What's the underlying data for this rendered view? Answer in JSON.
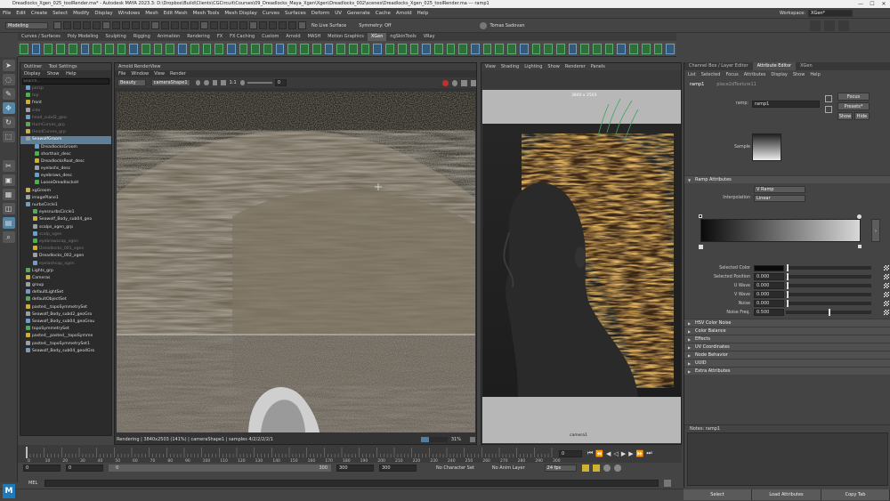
{
  "window": {
    "title": "Dreadlocks_Xgen_025_toolRender.ma* - Autodesk MAYA 2023.3: D:\\Dropbox\\Build\\Clients\\CGCircuit\\Courses\\09_Dreadlocks_Maya_Xgen\\Xgen\\Dreadlocks_002\\scenes\\Dreadlocks_Xgen_025_toolRender.ma --- ramp1",
    "controls": [
      "—",
      "☐",
      "✕"
    ]
  },
  "menu": [
    "File",
    "Edit",
    "Create",
    "Select",
    "Modify",
    "Display",
    "Windows",
    "Mesh",
    "Edit Mesh",
    "Mesh Tools",
    "Mesh Display",
    "Curves",
    "Surfaces",
    "Deform",
    "UV",
    "Generate",
    "Cache",
    "Arnold",
    "Help"
  ],
  "workspace": {
    "label": "Workspace:",
    "value": "XGen*"
  },
  "status": {
    "mode": "Modeling",
    "live_surface": "No Live Surface",
    "symmetry": "Symmetry: Off",
    "user": "Tomas Sadovan"
  },
  "shelf_tabs": [
    "Curves / Surfaces",
    "Poly Modeling",
    "Sculpting",
    "Rigging",
    "Animation",
    "Rendering",
    "FX",
    "FX Caching",
    "Custom",
    "Arnold",
    "MASH",
    "Motion Graphics",
    "XGen",
    "ngSkinTools",
    "VRay"
  ],
  "shelf_active": "XGen",
  "outliner": {
    "tabs": [
      "Outliner",
      "Tool Settings"
    ],
    "menu": [
      "Display",
      "Show",
      "Help"
    ],
    "search_placeholder": "Search...",
    "items": [
      {
        "label": "persp",
        "dim": true
      },
      {
        "label": "top",
        "dim": true
      },
      {
        "label": "front",
        "dim": false
      },
      {
        "label": "side",
        "dim": true
      },
      {
        "label": "head_subd2_geo",
        "dim": true
      },
      {
        "label": "HumCurves_grp",
        "dim": true
      },
      {
        "label": "HeadCurves_grp",
        "dim": true
      },
      {
        "label": "SeawolfGroom",
        "dim": false
      },
      {
        "label": "DreadlocksGroom",
        "dim": false
      },
      {
        "label": "shorthair_desc",
        "dim": false
      },
      {
        "label": "DreadlocksRoot_desc",
        "dim": false
      },
      {
        "label": "eyelashs_desc",
        "dim": false
      },
      {
        "label": "eyebrows_desc",
        "dim": false
      },
      {
        "label": "LooseDreadlocksH",
        "dim": false
      },
      {
        "label": "xgGroom",
        "dim": false
      },
      {
        "label": "imagePlane1",
        "dim": false
      },
      {
        "label": "nurbsCircle1",
        "dim": false
      },
      {
        "label": "eyesnurbsCircle1",
        "dim": false
      },
      {
        "label": "Seawolf_Body_sub04_geo",
        "dim": false
      },
      {
        "label": "scalps_xgen_grp",
        "dim": false
      },
      {
        "label": "scalp_xgen",
        "dim": true
      },
      {
        "label": "eyebrowscap_xgen",
        "dim": true
      },
      {
        "label": "Dreadlocks_001_xgen",
        "dim": true
      },
      {
        "label": "Dreadlocks_002_xgen",
        "dim": false
      },
      {
        "label": "eyelashcap_xgen",
        "dim": true
      },
      {
        "label": "Lights_grp",
        "dim": false
      },
      {
        "label": "Cameras",
        "dim": false
      },
      {
        "label": "group",
        "dim": false
      },
      {
        "label": "defaultLightSet",
        "dim": false
      },
      {
        "label": "defaultObjectSet",
        "dim": false
      },
      {
        "label": "pasted__topoSymmetrySet",
        "dim": false
      },
      {
        "label": "Seawolf_Body_subd2_geoGro",
        "dim": false
      },
      {
        "label": "Seawolf_Body_sub04_geoGrou",
        "dim": false
      },
      {
        "label": "topoSymmetrySet",
        "dim": false
      },
      {
        "label": "pasted__pasted__topoSymme",
        "dim": false
      },
      {
        "label": "pasted__topoSymmetrySet1",
        "dim": false
      },
      {
        "label": "Seawolf_Body_sub04_geo4Gro",
        "dim": false
      }
    ],
    "selected_index": 7
  },
  "render_view": {
    "title": "Arnold RenderView",
    "menu": [
      "File",
      "Window",
      "View",
      "Render"
    ],
    "aov": "Beauty",
    "camera": "cameraShape1",
    "ratio": "1:1",
    "exposure": "0",
    "status": "Rendering | 3840x2503 (141%) | cameraShape1 | samples 4/2/2/2/2/1",
    "progress": "31%",
    "progress_value": 0.31
  },
  "viewport": {
    "menu": [
      "View",
      "Shading",
      "Lighting",
      "Show",
      "Renderer",
      "Panels"
    ],
    "resolution": "3840 x 2503",
    "camera_label": "camera1"
  },
  "attr_editor": {
    "tabs": [
      "Channel Box / Layer Editor",
      "Attribute Editor",
      "XGen"
    ],
    "active_tab": "Attribute Editor",
    "menu": [
      "List",
      "Selected",
      "Focus",
      "Attributes",
      "Display",
      "Show",
      "Help"
    ],
    "node_tabs": [
      "ramp1",
      "place2dTexture11"
    ],
    "node_label": "ramp:",
    "node_name": "ramp1",
    "focus_btn": "Focus",
    "presets_btn": "Presets*",
    "show_btn": "Show",
    "hide_btn": "Hide",
    "sample_label": "Sample",
    "ramp_section": "Ramp Attributes",
    "type_label": "Type",
    "type_value": "V Ramp",
    "interp_label": "Interpolation",
    "interp_value": "Linear",
    "fields": [
      {
        "label": "Selected Color",
        "value": ""
      },
      {
        "label": "Selected Position",
        "value": "0.000"
      },
      {
        "label": "U Wave",
        "value": "0.000"
      },
      {
        "label": "V Wave",
        "value": "0.000"
      },
      {
        "label": "Noise",
        "value": "0.000"
      },
      {
        "label": "Noise Freq.",
        "value": "0.500"
      }
    ],
    "sections": [
      "HSV Color Noise",
      "Color Balance",
      "Effects",
      "UV Coordinates",
      "Node Behavior",
      "UUID",
      "Extra Attributes"
    ],
    "notes_label": "Notes: ramp1",
    "bottom_buttons": [
      "Select",
      "Load Attributes",
      "Copy Tab"
    ]
  },
  "timeline": {
    "ticks": [
      "0",
      "10",
      "20",
      "30",
      "40",
      "50",
      "60",
      "70",
      "80",
      "90",
      "100",
      "110",
      "120",
      "130",
      "140",
      "150",
      "160",
      "170",
      "180",
      "190",
      "200",
      "210",
      "220",
      "230",
      "240",
      "250",
      "260",
      "270",
      "280",
      "290",
      "300"
    ],
    "current_frame": "0",
    "range_start": "0",
    "range_inner_start": "0",
    "range_inner_end": "300",
    "range_end_a": "300",
    "range_end_b": "300",
    "character_set": "No Character Set",
    "anim_layer": "No Anim Layer",
    "fps": "24 fps"
  },
  "command_line": {
    "label": "MEL"
  }
}
